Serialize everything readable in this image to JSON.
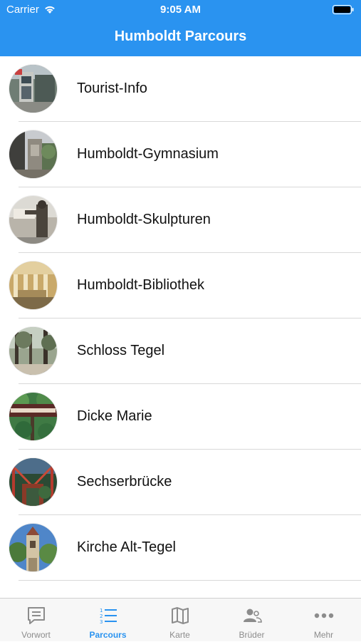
{
  "status_bar": {
    "carrier": "Carrier",
    "time": "9:05 AM"
  },
  "nav": {
    "title": "Humboldt Parcours"
  },
  "items": [
    {
      "label": "Tourist-Info",
      "image": "tourist-info-thumbnail"
    },
    {
      "label": "Humboldt-Gymnasium",
      "image": "gymnasium-thumbnail"
    },
    {
      "label": "Humboldt-Skulpturen",
      "image": "sculpture-thumbnail"
    },
    {
      "label": "Humboldt-Bibliothek",
      "image": "library-thumbnail"
    },
    {
      "label": "Schloss Tegel",
      "image": "castle-thumbnail"
    },
    {
      "label": "Dicke Marie",
      "image": "tree-sign-thumbnail"
    },
    {
      "label": "Sechserbrücke",
      "image": "bridge-thumbnail"
    },
    {
      "label": "Kirche Alt-Tegel",
      "image": "church-thumbnail"
    }
  ],
  "tabs": [
    {
      "label": "Vorwort",
      "icon": "speech-bubble-icon",
      "active": false
    },
    {
      "label": "Parcours",
      "icon": "list-icon",
      "active": true
    },
    {
      "label": "Karte",
      "icon": "map-icon",
      "active": false
    },
    {
      "label": "Brüder",
      "icon": "people-icon",
      "active": false
    },
    {
      "label": "Mehr",
      "icon": "more-dots-icon",
      "active": false
    }
  ],
  "colors": {
    "accent": "#2a93f0",
    "tab_inactive": "#8c8c8c",
    "separator": "#d9d9d9"
  }
}
